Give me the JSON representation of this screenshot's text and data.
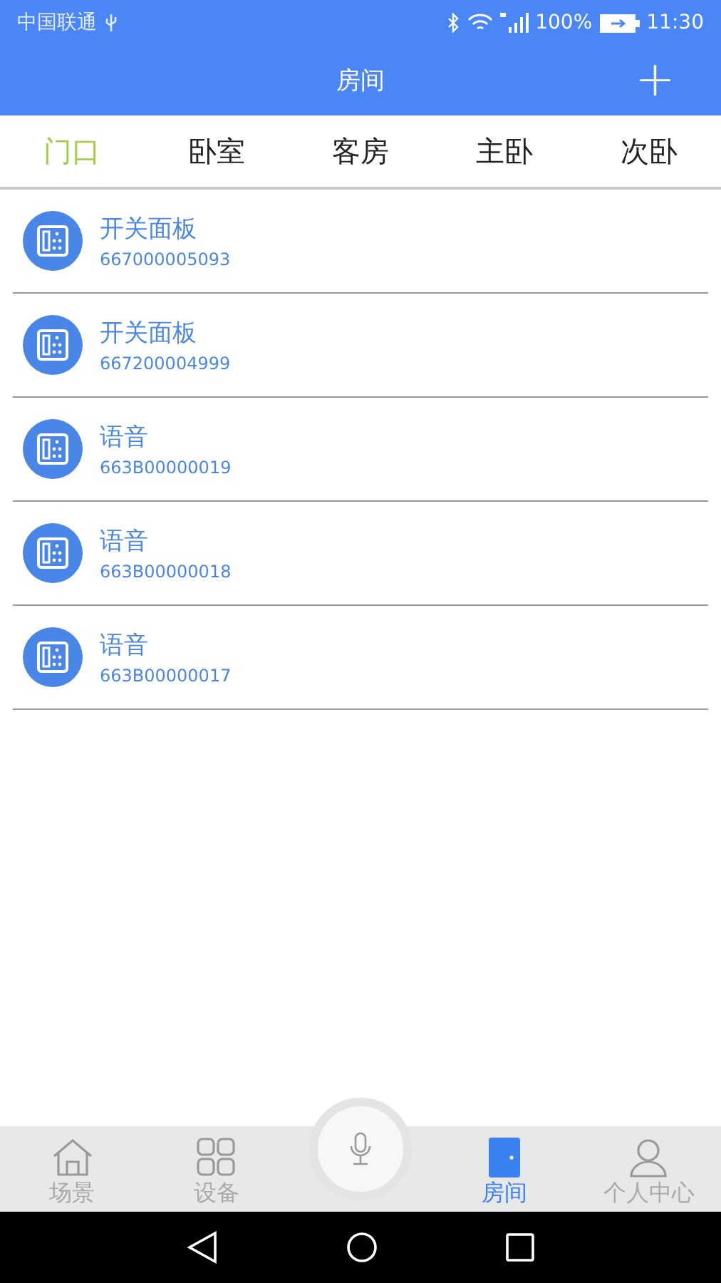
{
  "status_bar": {
    "carrier": "中国联通",
    "battery": "100%",
    "time": "11:30"
  },
  "header": {
    "title": "房间",
    "add_button": "+"
  },
  "tabs": [
    {
      "label": "门口",
      "selected": true
    },
    {
      "label": "卧室",
      "selected": false
    },
    {
      "label": "客房",
      "selected": false
    },
    {
      "label": "主卧",
      "selected": false
    },
    {
      "label": "次卧",
      "selected": false
    }
  ],
  "devices": [
    {
      "name": "开关面板",
      "serial": "667000005093"
    },
    {
      "name": "开关面板",
      "serial": "667200004999"
    },
    {
      "name": "语音",
      "serial": "663B00000019"
    },
    {
      "name": "语音",
      "serial": "663B00000018"
    },
    {
      "name": "语音",
      "serial": "663B00000017"
    }
  ],
  "bottom_nav": [
    {
      "label": "场景",
      "kind": "home",
      "selected": false
    },
    {
      "label": "设备",
      "kind": "grid",
      "selected": false
    },
    {
      "kind": "mic"
    },
    {
      "label": "房间",
      "kind": "door",
      "selected": true
    },
    {
      "label": "个人中心",
      "kind": "person",
      "selected": false
    }
  ]
}
